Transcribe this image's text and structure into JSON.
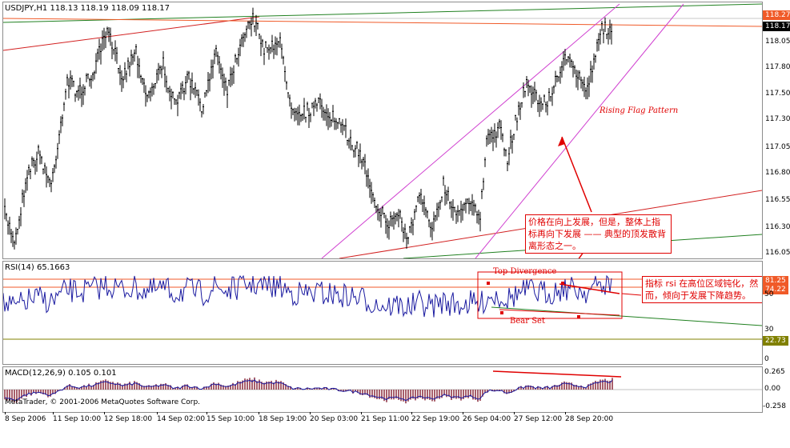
{
  "chart": {
    "title": "USDJPY,H1  118.13 118.19 118.09 118.17",
    "price_ticks": [
      "118.05",
      "117.80",
      "117.50",
      "117.30",
      "117.05",
      "116.80",
      "116.55",
      "116.30",
      "116.05"
    ],
    "tag_top": {
      "label": "118.27",
      "color": "#f05a28"
    },
    "tag_current": {
      "label": "118.17",
      "color": "#000000"
    },
    "pattern_label": "Rising  Flag  Pattern",
    "note": "价格在向上发展，但是，整体上指标再向下发展 —— 典型的顶发散背离形态之一。"
  },
  "rsi": {
    "title": "RSI(14) 65.1663",
    "tag_upper": {
      "label": "81.25",
      "color": "#f05a28"
    },
    "tag_upper2": {
      "label": "74.22",
      "color": "#f05a28"
    },
    "tick_mid": "50",
    "tick_low": "30",
    "tag_lower": {
      "label": "22.73",
      "color": "#808000"
    },
    "tick_zero": "0",
    "top_divergence": "Top   Divergence",
    "bear_set": "Bear Set",
    "note": "指标 rsi 在高位区域钝化，然而，倾向于发展下降趋势。"
  },
  "macd": {
    "title": "MACD(12,26,9) 0.105 0.101",
    "ticks": [
      "0.265",
      "0.00",
      "-0.258"
    ]
  },
  "copyright": "MetaTrader, © 2001-2006 MetaQuotes Software Corp.",
  "time_labels": [
    "8 Sep 2006",
    "11 Sep 10:00",
    "12 Sep 18:00",
    "14 Sep 02:00",
    "15 Sep 10:00",
    "18 Sep 19:00",
    "20 Sep 03:00",
    "21 Sep 11:00",
    "22 Sep 19:00",
    "26 Sep 04:00",
    "27 Sep 12:00",
    "28 Sep 20:00"
  ],
  "colors": {
    "candle": "#000000",
    "rsi_line": "#1a1aa0",
    "macd_hist": "#8b2a3a",
    "macd_signal": "#1a1aa0",
    "trend_red": "#d22020",
    "trend_green": "#208020",
    "channel": "#d040d0",
    "annotation": "#e00000"
  }
}
